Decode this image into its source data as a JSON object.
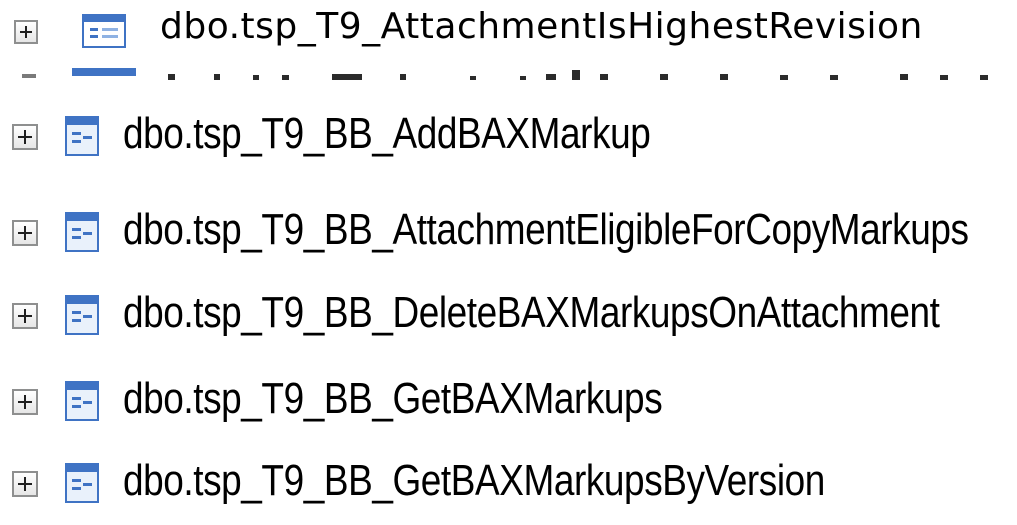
{
  "tree": {
    "items": [
      {
        "label": "dbo.tsp_T9_AttachmentIsHighestRevision",
        "icon": "stored-procedure-icon",
        "expander": "plus"
      },
      {
        "label": "dbo.tsp_T9_BB_AddBAXMarkup",
        "icon": "stored-procedure-icon",
        "expander": "plus"
      },
      {
        "label": "dbo.tsp_T9_BB_AttachmentEligibleForCopyMarkups",
        "icon": "stored-procedure-icon",
        "expander": "plus"
      },
      {
        "label": "dbo.tsp_T9_BB_DeleteBAXMarkupsOnAttachment",
        "icon": "stored-procedure-icon",
        "expander": "plus"
      },
      {
        "label": "dbo.tsp_T9_BB_GetBAXMarkups",
        "icon": "stored-procedure-icon",
        "expander": "plus"
      },
      {
        "label": "dbo.tsp_T9_BB_GetBAXMarkupsByVersion",
        "icon": "stored-procedure-icon",
        "expander": "plus"
      }
    ]
  },
  "colors": {
    "expander_border": "#8e8f8f",
    "icon_blue": "#3f73c4",
    "icon_light": "#cfe1f7",
    "text": "#000000"
  }
}
